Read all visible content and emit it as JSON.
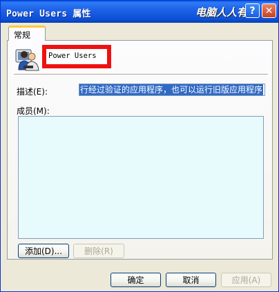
{
  "window": {
    "title": "Power Users 属性",
    "watermark": "电脑人人有",
    "help_symbol": "?",
    "close_symbol": "✕"
  },
  "tabs": [
    {
      "label": "常规"
    }
  ],
  "general": {
    "group_name": "Power Users",
    "description_label": "描述(E):",
    "description_value": "行经过验证的应用程序，也可以运行旧版应用程序",
    "members_label": "成员(M):",
    "members": []
  },
  "buttons": {
    "add": "添加(D)...",
    "remove": "删除(R)",
    "ok": "确定",
    "cancel": "取消",
    "apply": "应用(A)"
  },
  "icons": {
    "group": "users-group-icon",
    "help": "help-icon",
    "close": "close-icon"
  },
  "colors": {
    "titlebar": "#0a57e0",
    "highlight_border": "#ee1111",
    "selection": "#316ac5",
    "members_list_bg": "#e7fafc",
    "tab_accent": "#ffc83c"
  }
}
